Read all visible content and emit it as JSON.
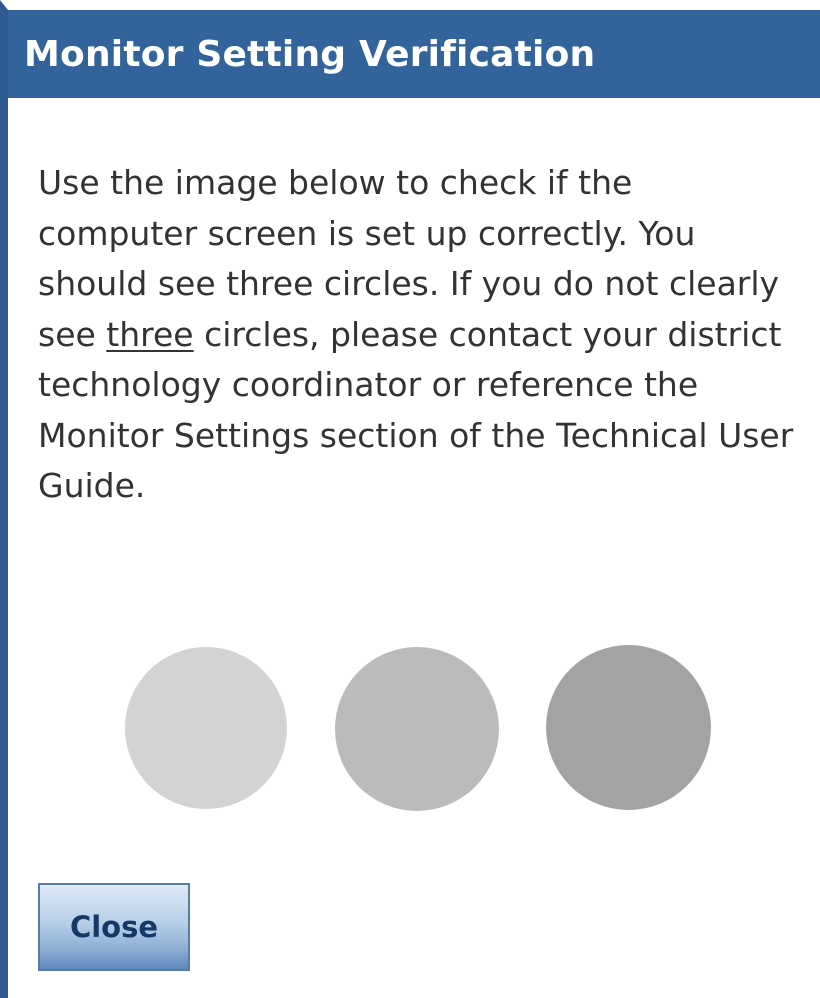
{
  "dialog": {
    "title": "Monitor Setting Verification",
    "instructions": {
      "part1": "Use the image below to check if the computer screen is set up correctly. You should see three circles. If you do not clearly see ",
      "emphasis": "three",
      "part2": " circles, please contact your district technology coordinator or reference the Monitor Settings section of the Technical User Guide."
    },
    "circles": [
      {
        "color": "#d3d3d5"
      },
      {
        "color": "#bbbbbd"
      },
      {
        "color": "#a3a3a6"
      }
    ],
    "close_label": "Close"
  },
  "colors": {
    "title_bar": "#32639a",
    "border": "#2e5b8f",
    "text": "#333333"
  }
}
